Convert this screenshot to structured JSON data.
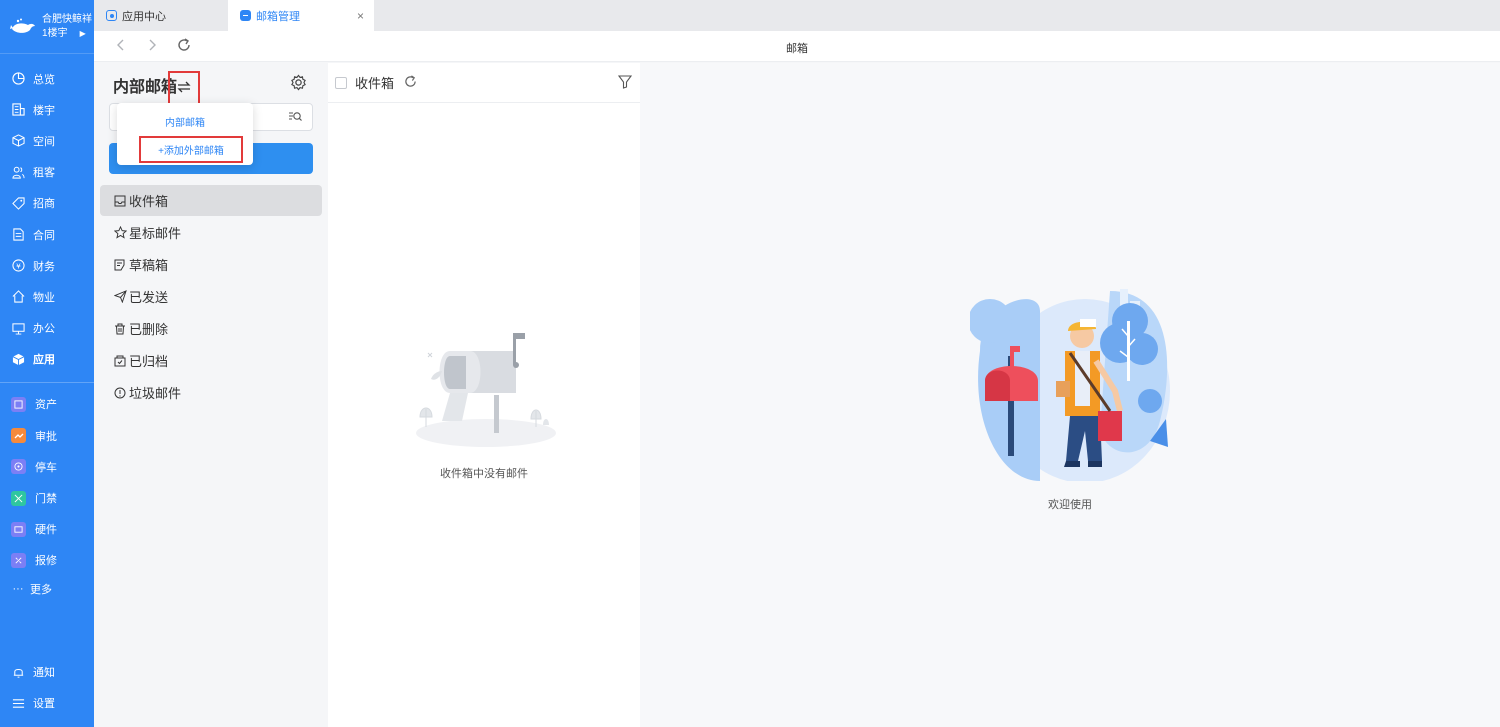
{
  "brand": {
    "name": "合肥快鲸祥",
    "building": "1楼宇"
  },
  "nav": {
    "main": [
      {
        "label": "总览",
        "icon": "dashboard-icon"
      },
      {
        "label": "楼宇",
        "icon": "building-icon"
      },
      {
        "label": "空间",
        "icon": "cube-icon"
      },
      {
        "label": "租客",
        "icon": "users-icon"
      },
      {
        "label": "招商",
        "icon": "tag-icon"
      },
      {
        "label": "合同",
        "icon": "document-icon"
      },
      {
        "label": "财务",
        "icon": "coin-icon"
      },
      {
        "label": "物业",
        "icon": "home-icon"
      },
      {
        "label": "办公",
        "icon": "monitor-icon"
      },
      {
        "label": "应用",
        "icon": "box-icon"
      }
    ],
    "apps": [
      {
        "label": "资产",
        "color": "#7b7ff5"
      },
      {
        "label": "审批",
        "color": "#f58a3c"
      },
      {
        "label": "停车",
        "color": "#7b7ff5"
      },
      {
        "label": "门禁",
        "color": "#2fc6a0"
      },
      {
        "label": "硬件",
        "color": "#7b7ff5"
      },
      {
        "label": "报修",
        "color": "#7b7ff5"
      }
    ],
    "more": "更多",
    "notify": "通知",
    "settings": "设置"
  },
  "tabs": [
    {
      "label": "应用中心"
    },
    {
      "label": "邮箱管理",
      "close": "×"
    }
  ],
  "address": {
    "title": "邮箱"
  },
  "mail": {
    "heading": "内部邮箱",
    "dropdown": {
      "internal": "内部邮箱",
      "add_external": "+添加外部邮箱"
    },
    "folders": [
      {
        "label": "收件箱",
        "icon": "inbox-icon"
      },
      {
        "label": "星标邮件",
        "icon": "star-icon"
      },
      {
        "label": "草稿箱",
        "icon": "draft-icon"
      },
      {
        "label": "已发送",
        "icon": "send-icon"
      },
      {
        "label": "已删除",
        "icon": "trash-icon"
      },
      {
        "label": "已归档",
        "icon": "archive-icon"
      },
      {
        "label": "垃圾邮件",
        "icon": "spam-icon"
      }
    ]
  },
  "list": {
    "title": "收件箱",
    "empty": "收件箱中没有邮件"
  },
  "right": {
    "welcome": "欢迎使用"
  },
  "colors": {
    "nav": "#2e86f5",
    "accent": "#2e8ff0",
    "highlight": "#e23a3a"
  }
}
